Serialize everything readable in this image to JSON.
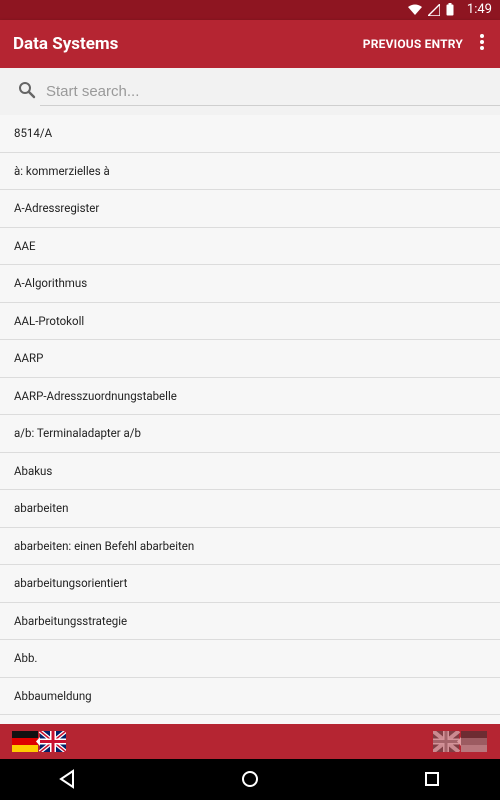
{
  "status_bar": {
    "time": "1:49",
    "icons": [
      "wifi-icon",
      "signal-icon",
      "battery-icon"
    ]
  },
  "app_bar": {
    "title": "Data Systems",
    "previous_entry": "PREVIOUS ENTRY",
    "more_icon": "more-vert-icon"
  },
  "search": {
    "placeholder": "Start search...",
    "value": ""
  },
  "list": {
    "items": [
      "8514/A",
      "à: kommerzielles à",
      "A-Adressregister",
      "AAE",
      "A-Algorithmus",
      "AAL-Protokoll",
      "AARP",
      "AARP-Adresszuordnungstabelle",
      "a/b: Terminaladapter a/b",
      "Abakus",
      "abarbeiten",
      "abarbeiten: einen Befehl abarbeiten",
      "abarbeitungsorientiert",
      "Abarbeitungsstrategie",
      "Abb.",
      "Abbaumeldung",
      ""
    ]
  },
  "bottom_bar": {
    "left_icon": "german-to-english-flags-icon",
    "right_icon": "english-to-german-flags-icon"
  },
  "nav_bar": {
    "buttons": [
      "back-icon",
      "home-icon",
      "recents-icon"
    ]
  },
  "colors": {
    "primary": "#b52532",
    "primary_dark": "#8e1521",
    "list_bg": "#f7f7f7",
    "divider": "#dcdcdc"
  }
}
